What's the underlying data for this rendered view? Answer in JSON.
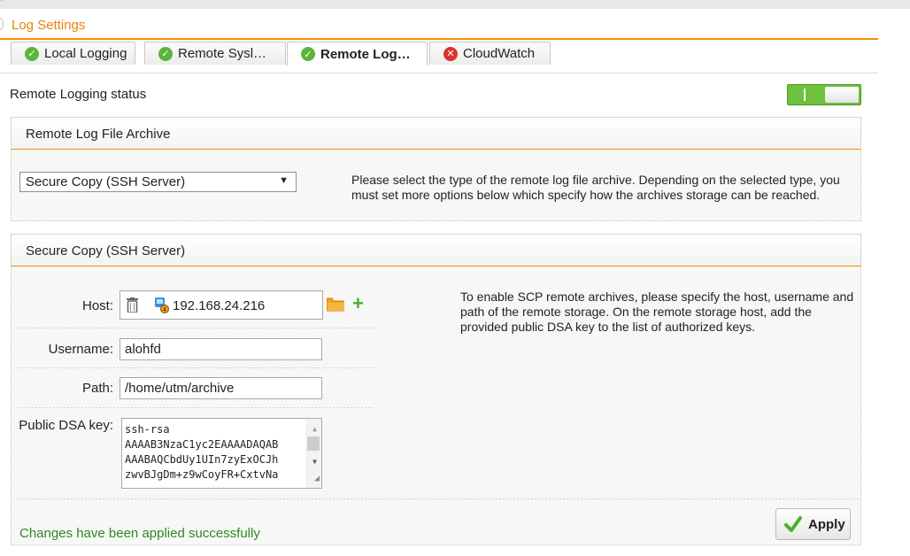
{
  "panel": {
    "title": "Log Settings"
  },
  "tabs": [
    {
      "label": "Local Logging",
      "status": "ok",
      "active": false
    },
    {
      "label": "Remote Sysl…",
      "status": "ok",
      "active": false
    },
    {
      "label": "Remote Log…",
      "status": "ok",
      "active": true
    },
    {
      "label": "CloudWatch",
      "status": "error",
      "active": false
    }
  ],
  "status": {
    "label": "Remote Logging status",
    "toggle_on": true,
    "toggle_on_glyph": "I"
  },
  "archive": {
    "title": "Remote Log File Archive",
    "selected_type": "Secure Copy (SSH Server)",
    "help": "Please select the type of the remote log file archive. Depending on the selected type, you must set more options below which specify how the archives storage can be reached."
  },
  "scp": {
    "title": "Secure Copy (SSH Server)",
    "host_label": "Host:",
    "host_value": "192.168.24.216",
    "username_label": "Username:",
    "username_value": "alohfd",
    "path_label": "Path:",
    "path_value": "/home/utm/archive",
    "key_label": "Public DSA key:",
    "key_lines": [
      "ssh-rsa",
      "AAAAB3NzaC1yc2EAAAADAQAB",
      "AAABAQCbdUy1UIn7zyExOCJh",
      "zwvBJgDm+z9wCoyFR+CxtvNa"
    ],
    "help": "To enable SCP remote archives, please specify the host, username and path of the remote storage. On the remote storage host, add the provided public DSA key to the list of authorized keys."
  },
  "footer": {
    "success_message": "Changes have been applied successfully",
    "apply_label": "Apply"
  },
  "colors": {
    "accent": "#f39200",
    "title": "#e8830a",
    "toggle": "#6ec13e",
    "success": "#2d8a1f",
    "error": "#d9342b"
  }
}
